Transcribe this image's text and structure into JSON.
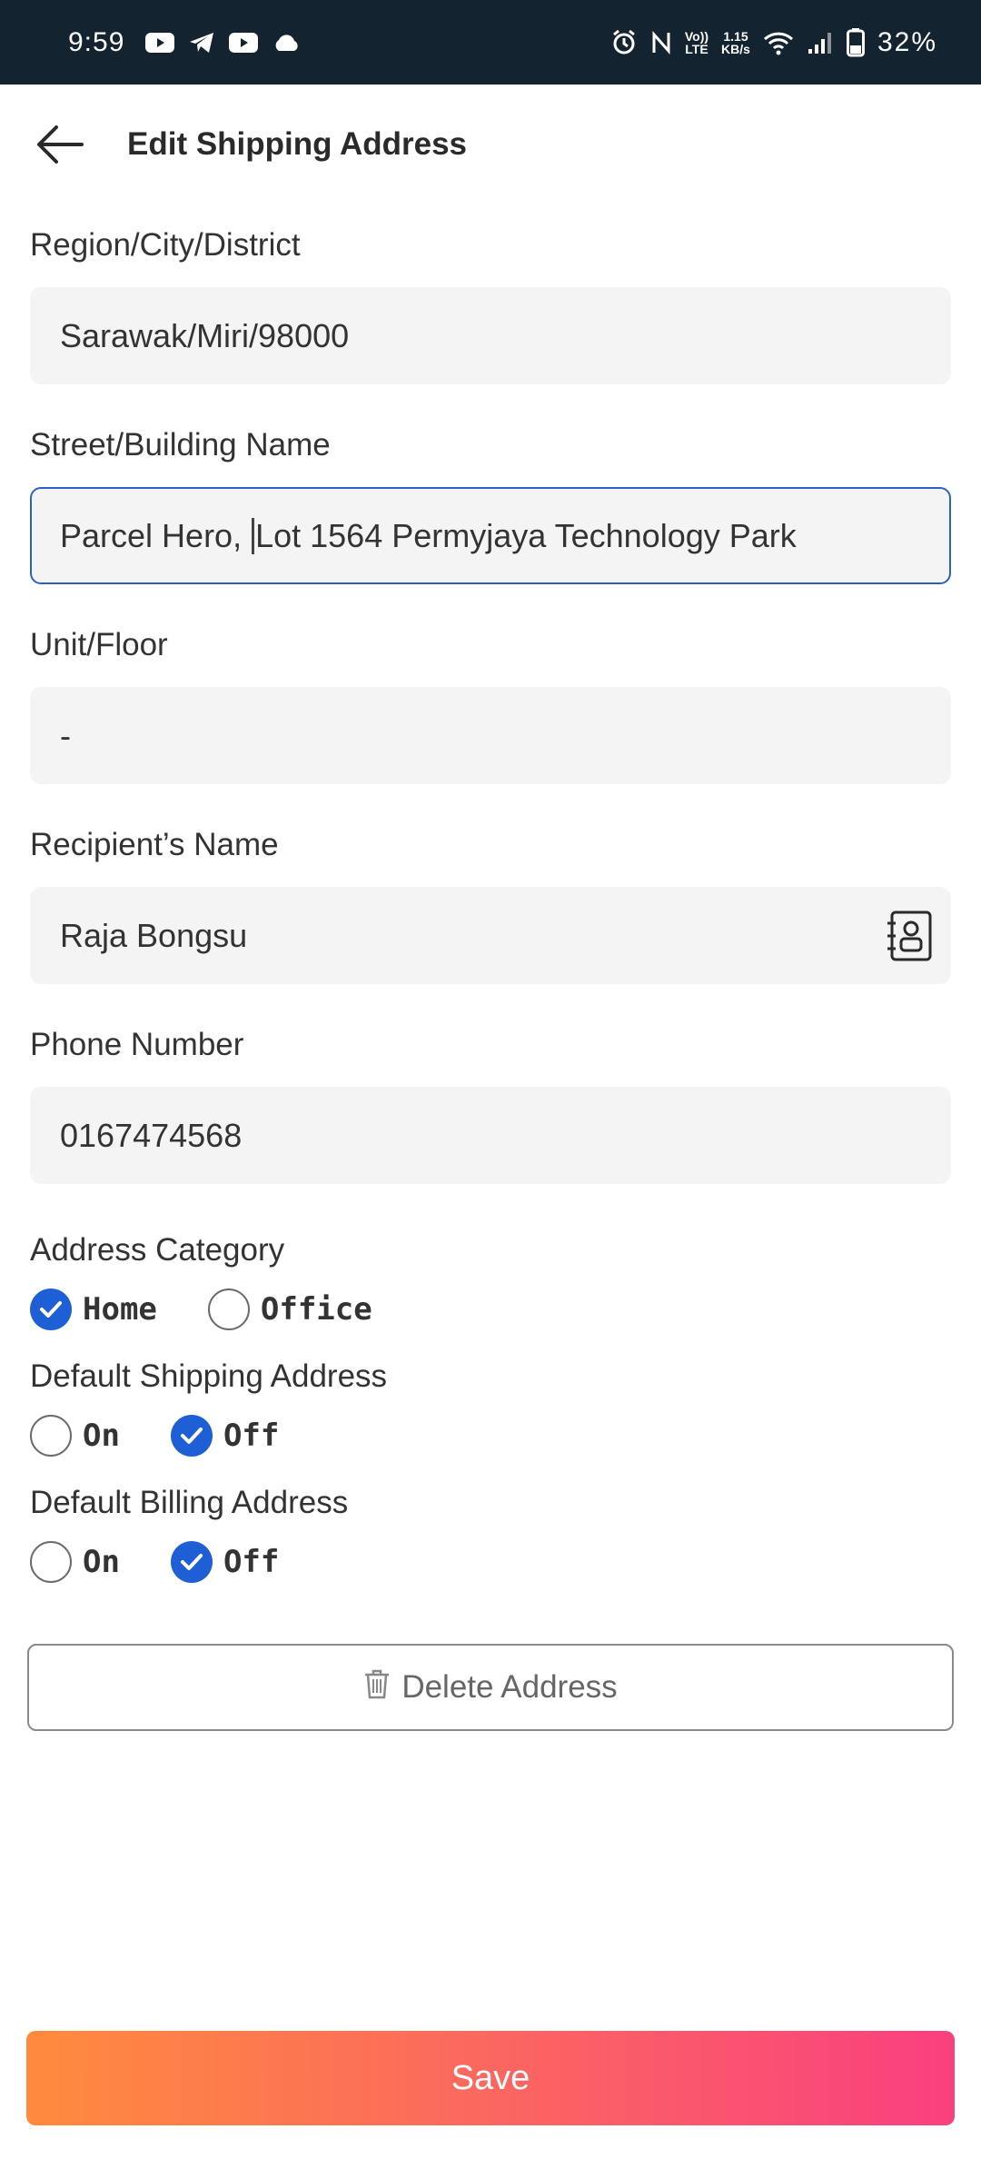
{
  "status_bar": {
    "time": "9:59",
    "left_icons": [
      "youtube-icon",
      "telegram-icon",
      "youtube-icon",
      "cloud-icon"
    ],
    "right_icons": [
      "alarm-icon",
      "nfc-icon",
      "volte-icon",
      "wifi-icon",
      "signal-icon",
      "battery-icon"
    ],
    "volte_top": "Vo))",
    "volte_bottom": "LTE",
    "speed_top": "1.15",
    "speed_bottom": "KB/s",
    "battery": "32%"
  },
  "header": {
    "title": "Edit Shipping Address"
  },
  "form": {
    "region_label": "Region/City/District",
    "region_value": "Sarawak/Miri/98000",
    "street_label": "Street/Building Name",
    "street_value_before_caret": "Parcel Hero, ",
    "street_value_after_caret": "Lot 1564 Permyjaya Technology Park",
    "unit_label": "Unit/Floor",
    "unit_value": "-",
    "recipient_label": "Recipient’s Name",
    "recipient_value": "Raja Bongsu",
    "phone_label": "Phone Number",
    "phone_value": "0167474568"
  },
  "address_category": {
    "label": "Address Category",
    "options": [
      {
        "label": "Home",
        "checked": true
      },
      {
        "label": "Office",
        "checked": false
      }
    ]
  },
  "default_shipping": {
    "label": "Default Shipping Address",
    "options": [
      {
        "label": "On",
        "checked": false
      },
      {
        "label": "Off",
        "checked": true
      }
    ]
  },
  "default_billing": {
    "label": "Default Billing Address",
    "options": [
      {
        "label": "On",
        "checked": false
      },
      {
        "label": "Off",
        "checked": true
      }
    ]
  },
  "actions": {
    "delete_label": "Delete Address",
    "save_label": "Save"
  },
  "colors": {
    "status_bar_bg": "#13232f",
    "focus_border": "#2e5fc7",
    "radio_checked": "#1f5fd6",
    "save_gradient_start": "#ff8b3d",
    "save_gradient_end": "#f9407f"
  }
}
